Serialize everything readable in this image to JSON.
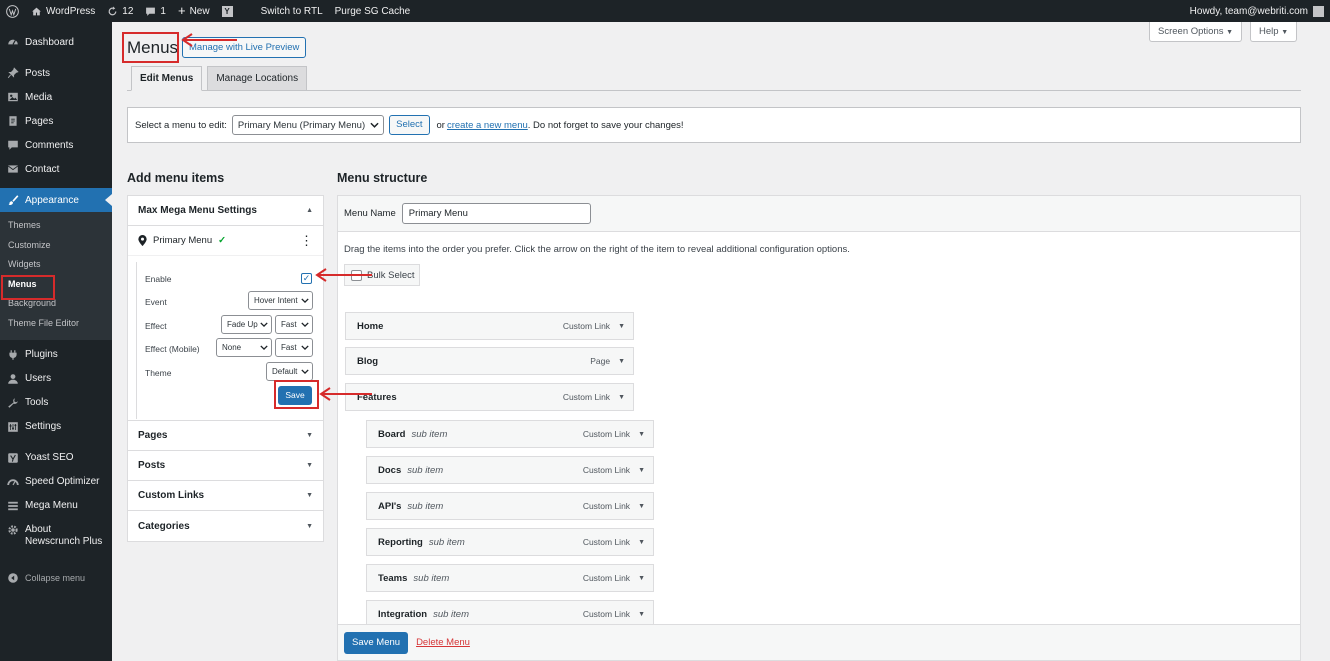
{
  "adminbar": {
    "site_name": "WordPress",
    "updates_count": "12",
    "comments_count": "1",
    "new_label": "New",
    "rtl_label": "Switch to RTL",
    "purge_label": "Purge SG Cache",
    "howdy_label": "Howdy, team@webriti.com"
  },
  "sidebar": {
    "items": [
      {
        "label": "Dashboard",
        "icon": "dashboard-icon"
      },
      {
        "label": "Posts",
        "icon": "pin-icon"
      },
      {
        "label": "Media",
        "icon": "media-icon"
      },
      {
        "label": "Pages",
        "icon": "pages-icon"
      },
      {
        "label": "Comments",
        "icon": "comment-icon"
      },
      {
        "label": "Contact",
        "icon": "mail-icon"
      },
      {
        "label": "Appearance",
        "icon": "brush-icon"
      },
      {
        "label": "Plugins",
        "icon": "plug-icon"
      },
      {
        "label": "Users",
        "icon": "user-icon"
      },
      {
        "label": "Tools",
        "icon": "wrench-icon"
      },
      {
        "label": "Settings",
        "icon": "sliders-icon"
      },
      {
        "label": "Yoast SEO",
        "icon": "yoast-icon"
      },
      {
        "label": "Speed Optimizer",
        "icon": "speedometer-icon"
      },
      {
        "label": "Mega Menu",
        "icon": "menu-icon"
      },
      {
        "label": "About",
        "label2": "Newscrunch Plus",
        "icon": "gear-icon"
      }
    ],
    "appearance_sub": [
      "Themes",
      "Customize",
      "Widgets",
      "Menus",
      "Background",
      "Theme File Editor"
    ],
    "collapse_label": "Collapse menu"
  },
  "header": {
    "title": "Menus",
    "live_preview": "Manage with Live Preview",
    "screen_options": "Screen Options",
    "help": "Help"
  },
  "tabs": [
    {
      "label": "Edit Menus",
      "active": true
    },
    {
      "label": "Manage Locations",
      "active": false
    }
  ],
  "manage": {
    "prompt": "Select a menu to edit:",
    "selected_menu": "Primary Menu (Primary Menu)",
    "select_button": "Select",
    "or_text": "or",
    "create_link": "create a new menu",
    "reminder": ". Do not forget to save your changes!"
  },
  "add_items": {
    "title": "Add menu items",
    "mega_title": "Max Mega Menu Settings",
    "location_label": "Primary Menu",
    "settings": {
      "enable_label": "Enable",
      "enabled": true,
      "event_label": "Event",
      "event_value": "Hover Intent",
      "effect_label": "Effect",
      "effect_value": "Fade Up",
      "effect_speed": "Fast",
      "effect_mobile_label": "Effect (Mobile)",
      "effect_mobile_value": "None",
      "effect_mobile_speed": "Fast",
      "theme_label": "Theme",
      "theme_value": "Default",
      "save_label": "Save"
    },
    "sections": [
      "Pages",
      "Posts",
      "Custom Links",
      "Categories"
    ]
  },
  "structure": {
    "title": "Menu structure",
    "name_label": "Menu Name",
    "name_value": "Primary Menu",
    "instructions": "Drag the items into the order you prefer. Click the arrow on the right of the item to reveal additional configuration options.",
    "bulk_label": "Bulk Select",
    "items": [
      {
        "title": "Home",
        "sub": "",
        "kind": "Custom Link"
      },
      {
        "title": "Blog",
        "sub": "",
        "kind": "Page"
      },
      {
        "title": "Features",
        "sub": "",
        "kind": "Custom Link"
      },
      {
        "title": "Board",
        "sub": "sub item",
        "kind": "Custom Link"
      },
      {
        "title": "Docs",
        "sub": "sub item",
        "kind": "Custom Link"
      },
      {
        "title": "API's",
        "sub": "sub item",
        "kind": "Custom Link"
      },
      {
        "title": "Reporting",
        "sub": "sub item",
        "kind": "Custom Link"
      },
      {
        "title": "Teams",
        "sub": "sub item",
        "kind": "Custom Link"
      },
      {
        "title": "Integration",
        "sub": "sub item",
        "kind": "Custom Link"
      }
    ],
    "save_menu": "Save Menu",
    "delete_menu": "Delete Menu"
  },
  "colors": {
    "admin_dark": "#1d2327",
    "accent_blue": "#2271b1",
    "annotation_red": "#d62b2b"
  }
}
